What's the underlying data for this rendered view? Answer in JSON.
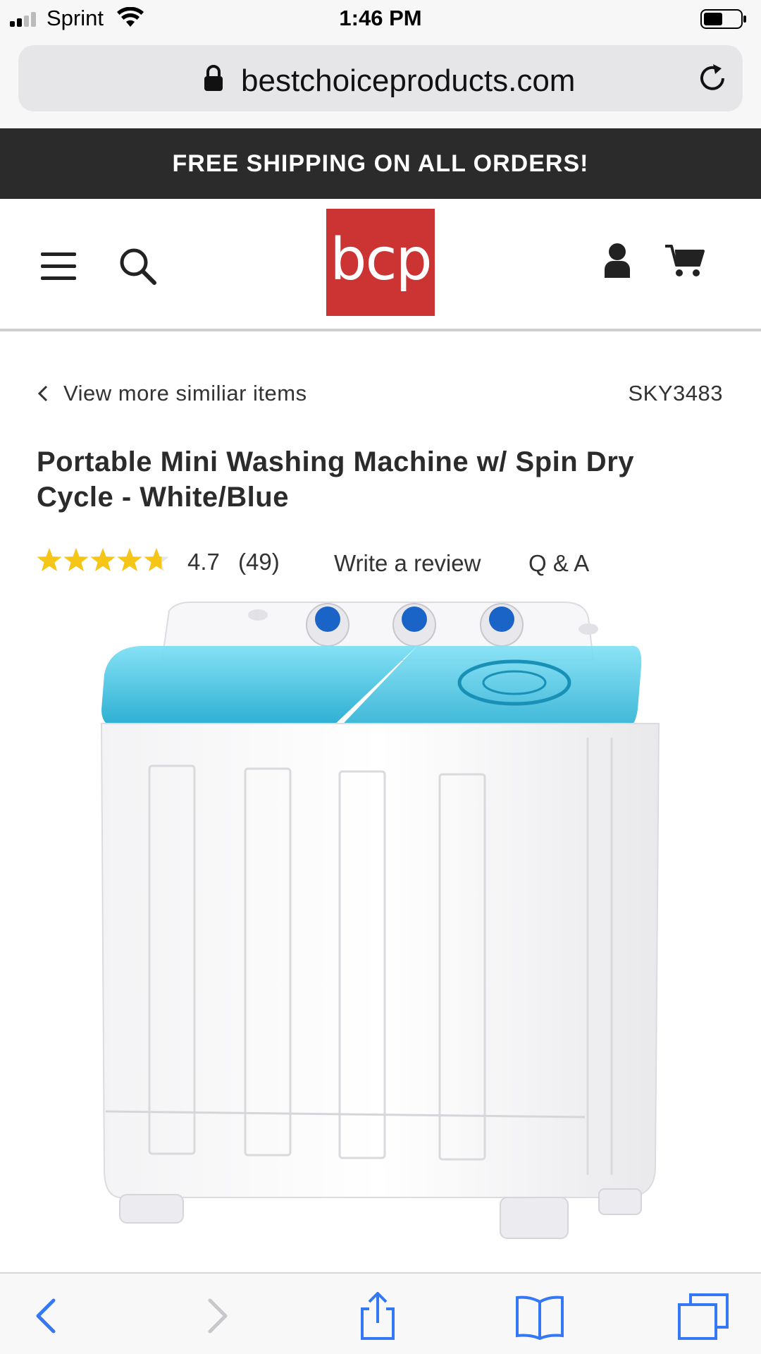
{
  "status_bar": {
    "carrier": "Sprint",
    "time": "1:46 PM"
  },
  "browser": {
    "url": "bestchoiceproducts.com"
  },
  "promo": {
    "text": "FREE SHIPPING ON ALL ORDERS!"
  },
  "header": {
    "logo_text": "bcp",
    "logo_color": "#cc3333"
  },
  "product": {
    "back_link": "View more similiar items",
    "sku": "SKY3483",
    "title": "Portable Mini Washing Machine w/ Spin Dry Cycle - White/Blue",
    "rating": "4.7",
    "rating_stars": 4.7,
    "review_count": "(49)",
    "write_review": "Write a review",
    "qa": "Q & A"
  },
  "colors": {
    "accent_blue": "#3478f6",
    "star_yellow": "#f5c518",
    "lid_blue": "#3cc3e3"
  }
}
